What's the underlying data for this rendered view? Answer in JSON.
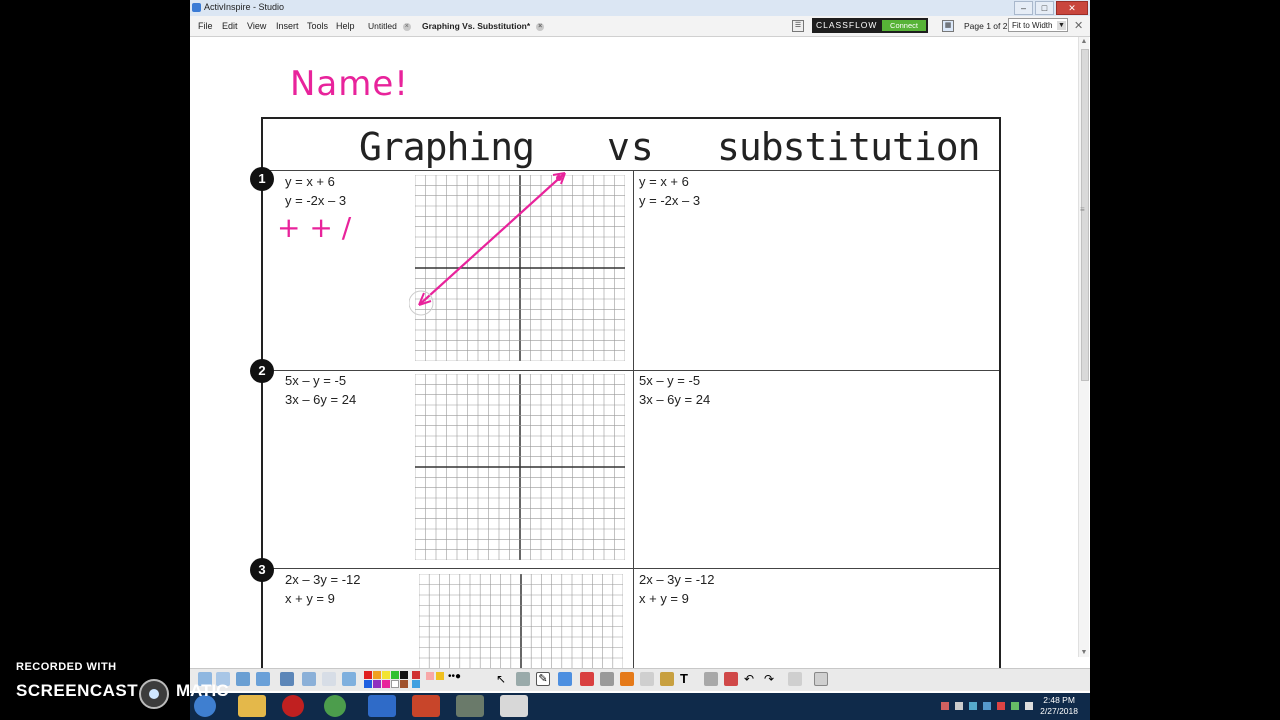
{
  "window": {
    "title": "ActivInspire - Studio"
  },
  "menu": {
    "items": [
      "File",
      "Edit",
      "View",
      "Insert",
      "Tools",
      "Help"
    ]
  },
  "tabs": [
    {
      "label": "Untitled",
      "active": false
    },
    {
      "label": "Graphing Vs. Substitution*",
      "active": true
    }
  ],
  "classflow": {
    "logo": "CLASSFLOW",
    "connect": "Connect"
  },
  "page_indicator": "Page 1 of 2",
  "zoom": "Fit to Width",
  "worksheet": {
    "handwritten_name": "Name!",
    "title_left": "Graphing",
    "title_mid": "vs",
    "title_right": "substitution",
    "problems": [
      {
        "number": "1",
        "eq1": "y = x + 6",
        "eq2": "y = -2x – 3",
        "note": "+ + /"
      },
      {
        "number": "2",
        "eq1": "5x – y = -5",
        "eq2": "3x – 6y = 24"
      },
      {
        "number": "3",
        "eq1": "2x – 3y = -12",
        "eq2": "x + y = 9"
      }
    ]
  },
  "colors": {
    "pen": "#e8239b",
    "accent": "#57b337"
  },
  "watermark": {
    "line1": "RECORDED WITH",
    "line2": "SCREENCAST",
    "line3": "MATIC"
  },
  "clock": {
    "time": "2:48 PM",
    "date": "2/27/2018"
  }
}
